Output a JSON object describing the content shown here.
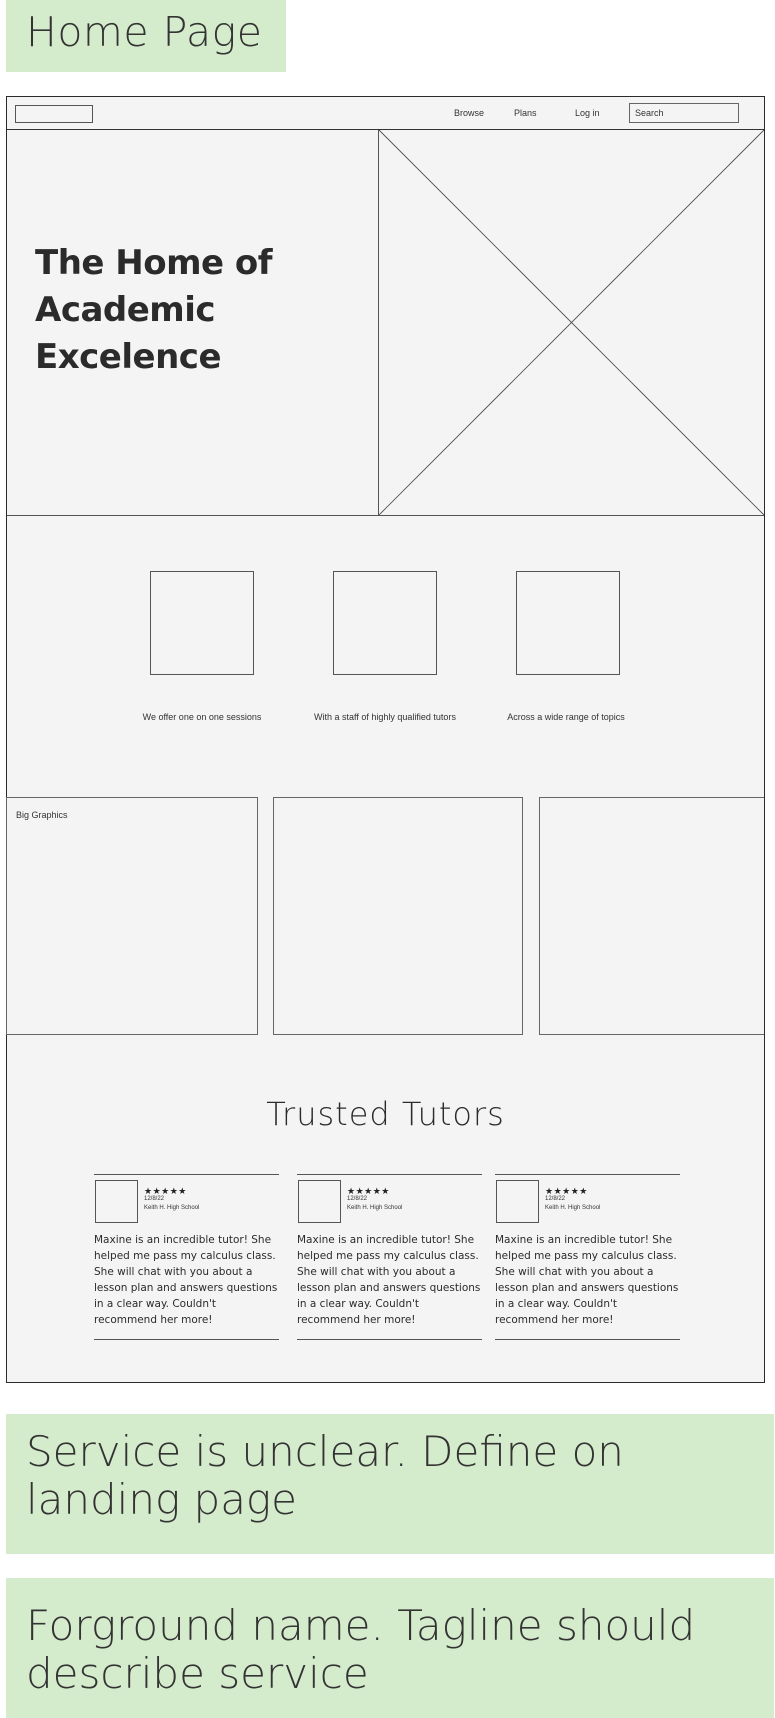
{
  "notes": {
    "title": "Home Page",
    "note1": "Service is unclear. Define on landing page",
    "note2": "Forground name. Tagline should describe service"
  },
  "nav": {
    "browse": "Browse",
    "plans": "Plans",
    "login": "Log in",
    "search_placeholder": "Search"
  },
  "hero": {
    "title": "The Home of Academic Excelence"
  },
  "features": [
    {
      "text": "We offer one on one sessions"
    },
    {
      "text": "With a staff of highly qualified tutors"
    },
    {
      "text": "Across a wide range of topics"
    }
  ],
  "graphics": {
    "label": "Big Graphics"
  },
  "tutors": {
    "title": "Trusted Tutors",
    "reviews": [
      {
        "stars": "★★★★★",
        "date": "12/8/22",
        "school": "Keith H. High School",
        "text": "Maxine is an incredible tutor! She helped me pass my calculus class. She will chat with you about a lesson plan and answers questions in a clear way. Couldn't recommend her more!"
      },
      {
        "stars": "★★★★★",
        "date": "12/8/22",
        "school": "Keith H. High School",
        "text": "Maxine is an incredible tutor! She helped me pass my calculus class. She will chat with you about a lesson plan and answers questions in a clear way. Couldn't recommend her more!"
      },
      {
        "stars": "★★★★★",
        "date": "12/8/22",
        "school": "Keith H. High School",
        "text": "Maxine is an incredible tutor! She helped me pass my calculus class. She will chat with you about a lesson plan and answers questions in a clear way. Couldn't recommend her more!"
      }
    ]
  }
}
